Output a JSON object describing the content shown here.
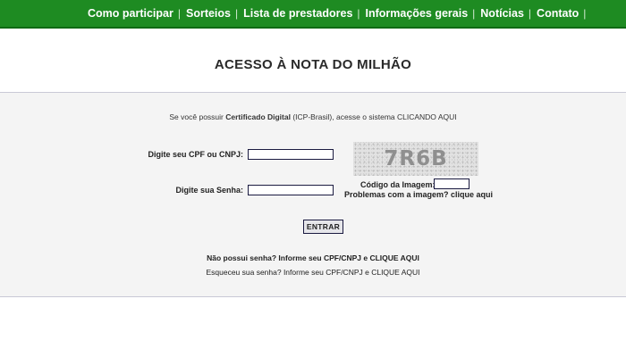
{
  "nav": {
    "items": [
      {
        "label": "Como participar"
      },
      {
        "label": "Sorteios"
      },
      {
        "label": "Lista de prestadores"
      },
      {
        "label": "Informações gerais"
      },
      {
        "label": "Notícias"
      },
      {
        "label": "Contato"
      }
    ],
    "separator": "|"
  },
  "page": {
    "title": "ACESSO À NOTA DO MILHÃO"
  },
  "cert": {
    "prefix": "Se você possuir ",
    "bold": "Certificado Digital",
    "middle": " (ICP-Brasil), acesse o sistema ",
    "link": "CLICANDO AQUI"
  },
  "form": {
    "cpf_label": "Digite seu CPF ou CNPJ:",
    "cpf_value": "",
    "password_label": "Digite sua Senha:",
    "password_value": "",
    "captcha_text": "7R6B",
    "captcha_code_label": "Código da Imagem:",
    "captcha_code_value": "",
    "captcha_problem": "Problemas com a imagem? clique aqui",
    "submit_label": "ENTRAR"
  },
  "help": {
    "no_password": "Não possui senha? Informe seu CPF/CNPJ e CLIQUE AQUI",
    "forgot_password": "Esqueceu sua senha? Informe seu CPF/CNPJ e  CLIQUE AQUI"
  }
}
